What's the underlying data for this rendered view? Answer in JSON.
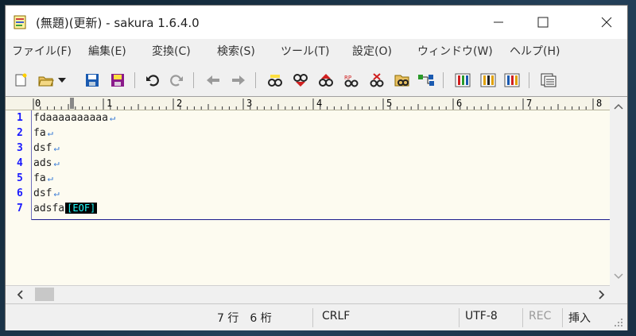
{
  "window": {
    "title": "(無題)(更新) - sakura 1.6.4.0"
  },
  "menu": [
    "ファイル(F)",
    "編集(E)",
    "変換(C)",
    "検索(S)",
    "ツール(T)",
    "設定(O)",
    "ウィンドウ(W)",
    "ヘルプ(H)"
  ],
  "toolbar": {
    "icons": [
      "new-file-icon",
      "open-file-icon",
      "open-dropdown-icon",
      "save-icon",
      "save-as-icon",
      "undo-icon",
      "redo-icon",
      "jump-back-icon",
      "jump-forward-icon",
      "search-icon",
      "search-prev-icon",
      "search-next-icon",
      "replace-icon",
      "clear-search-icon",
      "grep-icon",
      "outline-icon",
      "settings-icon",
      "font-icon",
      "type-settings-icon",
      "window-list-icon"
    ]
  },
  "editor": {
    "ruler_numbers": [
      "0",
      "1",
      "2",
      "3",
      "4",
      "5",
      "6",
      "7",
      "8"
    ],
    "lines": [
      {
        "num": "1",
        "text": "fdaaaaaaaaaa",
        "end": "crlf"
      },
      {
        "num": "2",
        "text": "fa",
        "end": "crlf"
      },
      {
        "num": "3",
        "text": "dsf",
        "end": "crlf"
      },
      {
        "num": "4",
        "text": "ads",
        "end": "crlf"
      },
      {
        "num": "5",
        "text": "fa",
        "end": "crlf"
      },
      {
        "num": "6",
        "text": "dsf",
        "end": "crlf"
      },
      {
        "num": "7",
        "text": "adsfa",
        "end": "eof"
      }
    ],
    "crlf_mark": "↵",
    "eof_mark": "[EOF]"
  },
  "status": {
    "position": "7 行　6 桁",
    "line_ending": "CRLF",
    "encoding": "UTF-8",
    "rec": "REC",
    "mode": "挿入"
  },
  "colors": {
    "editor_bg": "#fdfbf0",
    "line_number": "#1a1aff",
    "crlf": "#3a7cd6",
    "eof_bg": "#000000",
    "eof_fg": "#22ffff",
    "rec_disabled": "#9a9a9a"
  }
}
